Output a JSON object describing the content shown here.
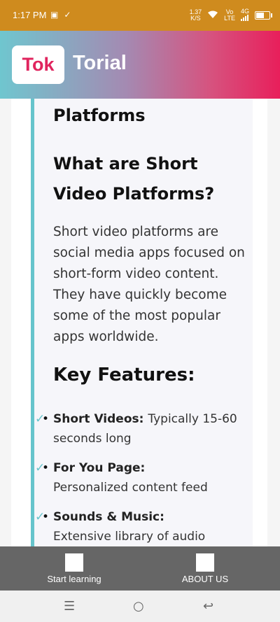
{
  "status": {
    "time": "1:17 PM",
    "speed_top": "1.37",
    "speed_unit": "K/S",
    "volte_top": "Vo",
    "volte_bottom": "LTE",
    "network": "4G",
    "battery_level": 0.6
  },
  "header": {
    "logo_text": "Tok",
    "app_name": "Torial"
  },
  "article": {
    "top_heading": "Platforms",
    "heading": "What are Short Video Platforms?",
    "paragraph": "Short video platforms are social media apps focused on short-form video content. They have quickly become some of the most popular apps worldwide.",
    "features_heading": "Key Features:",
    "features": [
      {
        "title": "Short Videos:",
        "desc": "Typically 15-60 seconds long"
      },
      {
        "title": "For You Page:",
        "desc": "Personalized content feed"
      },
      {
        "title": "Sounds & Music:",
        "desc": "Extensive library of audio"
      }
    ]
  },
  "bottom_nav": {
    "start_label": "Start learning",
    "about_label": "ABOUT US"
  }
}
